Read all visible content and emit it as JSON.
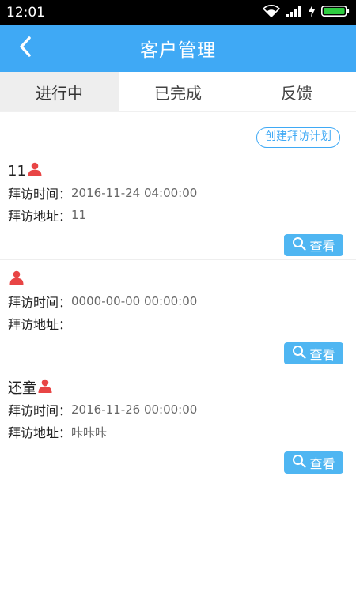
{
  "status_bar": {
    "time": "12:01"
  },
  "header": {
    "title": "客户管理",
    "back_icon": "chevron-left-icon"
  },
  "tabs": [
    {
      "label": "进行中",
      "active": true
    },
    {
      "label": "已完成",
      "active": false
    },
    {
      "label": "反馈",
      "active": false
    }
  ],
  "create_button": {
    "label": "创建拜访计划"
  },
  "visits": [
    {
      "name": "11",
      "time_label": "拜访时间：",
      "time": "2016-11-24 04:00:00",
      "address_label": "拜访地址：",
      "address": "11",
      "view_label": "查看"
    },
    {
      "name": "",
      "time_label": "拜访时间：",
      "time": "0000-00-00 00:00:00",
      "address_label": "拜访地址：",
      "address": "",
      "view_label": "查看"
    },
    {
      "name": "还童",
      "time_label": "拜访时间：",
      "time": "2016-11-26 00:00:00",
      "address_label": "拜访地址：",
      "address": "咔咔咔",
      "view_label": "查看"
    }
  ],
  "colors": {
    "primary": "#3fa9f5",
    "person_icon": "#e84545",
    "view_button": "#4fb6f2"
  }
}
